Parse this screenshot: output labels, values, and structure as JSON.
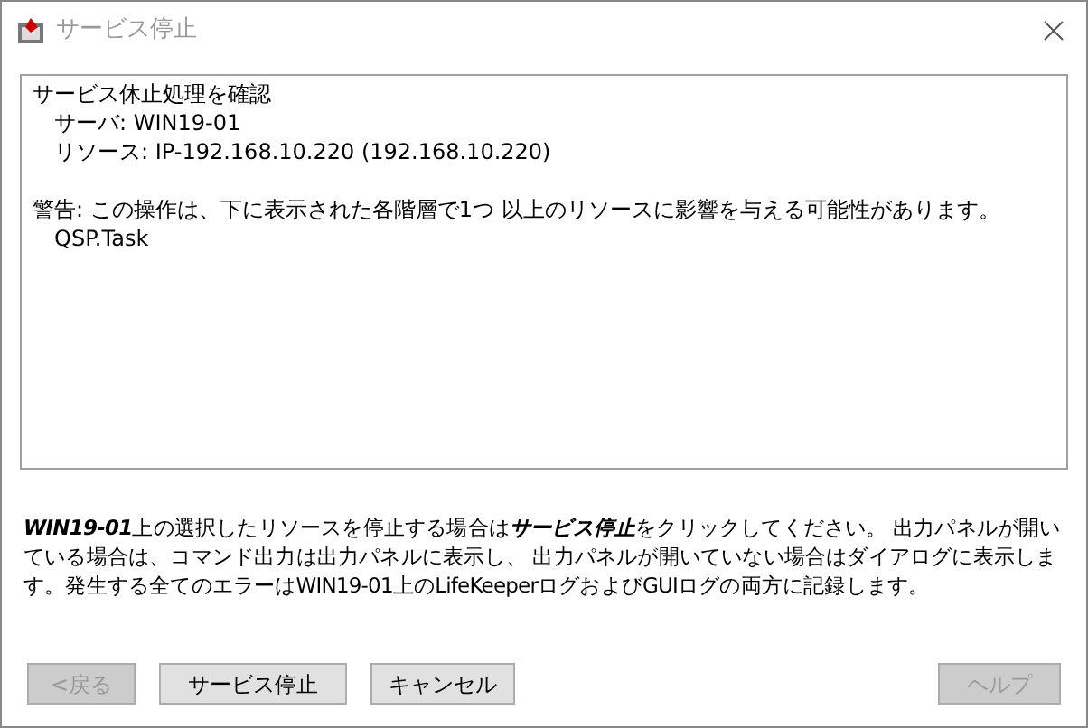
{
  "window": {
    "title": "サービス停止"
  },
  "output": {
    "sections": [
      {
        "text": "サービス休止処理を確認",
        "children": [
          "サーバ: WIN19-01",
          "リソース: IP-192.168.10.220 (192.168.10.220)"
        ]
      },
      {
        "text": "警告: この操作は、下に表示された各階層で1つ 以上のリソースに影響を与える可能性があります。",
        "children": [
          "QSP.Task"
        ]
      }
    ]
  },
  "message": "**WIN19-01**上の選択したリソースを停止する場合は**サービス停止**をクリックしてください。 出力パネルが開いている場合は、コマンド出力は出力パネルに表示し、 出力パネルが開いていない場合はダイアログに表示します。発生する全てのエラーはWIN19-01上のLifeKeeperログおよびGUIログの両方に記録します。",
  "buttons": [
    {
      "label": "<戻る",
      "disabled": true
    },
    {
      "label": "サービス停止",
      "disabled": false
    },
    {
      "label": "キャンセル",
      "disabled": false
    },
    {
      "label": "ヘルプ",
      "disabled": true
    }
  ]
}
